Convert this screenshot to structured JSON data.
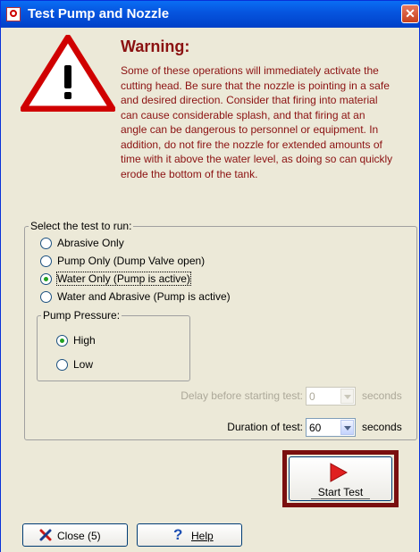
{
  "window": {
    "title": "Test Pump and Nozzle",
    "close_glyph": "✕"
  },
  "warning": {
    "heading": "Warning:",
    "body": "Some of these operations will immediately activate the\ncutting head. Be sure that the nozzle is pointing in a safe\nand desired direction.  Consider that firing into material\ncan cause considerable splash, and that firing at an\nangle can be dangerous to personnel or equipment. In\naddition, do not fire the nozzle for extended amounts of\ntime with it above the water level, as doing so can quickly\nerode the bottom of the tank.",
    "icon": "warning-triangle-icon",
    "color": "#8b1111"
  },
  "test_group": {
    "legend": "Select the test to run:",
    "options": [
      {
        "label": "Abrasive Only",
        "checked": false
      },
      {
        "label": "Pump Only (Dump Valve open)",
        "checked": false
      },
      {
        "label": "Water Only (Pump is active)",
        "checked": true
      },
      {
        "label": "Water and Abrasive (Pump is active)",
        "checked": false
      }
    ]
  },
  "pressure_group": {
    "legend": "Pump Pressure:",
    "options": [
      {
        "label": "High",
        "checked": true
      },
      {
        "label": "Low",
        "checked": false
      }
    ]
  },
  "delay": {
    "label": "Delay before starting test:",
    "value": "0",
    "unit": "seconds",
    "enabled": false
  },
  "duration": {
    "label": "Duration of test:",
    "value": "60",
    "unit": "seconds",
    "enabled": true
  },
  "start_button": {
    "label": "Start Test",
    "icon": "play-icon",
    "highlight_color": "#7a0f0f"
  },
  "footer": {
    "close_label": "Close (5)",
    "close_icon": "close-x-icon",
    "help_label": "Help",
    "help_icon": "question-mark-icon"
  },
  "colors": {
    "titlebar": "#0656e0",
    "dialog_bg": "#ece9d8",
    "radio_dot": "#21a121"
  }
}
